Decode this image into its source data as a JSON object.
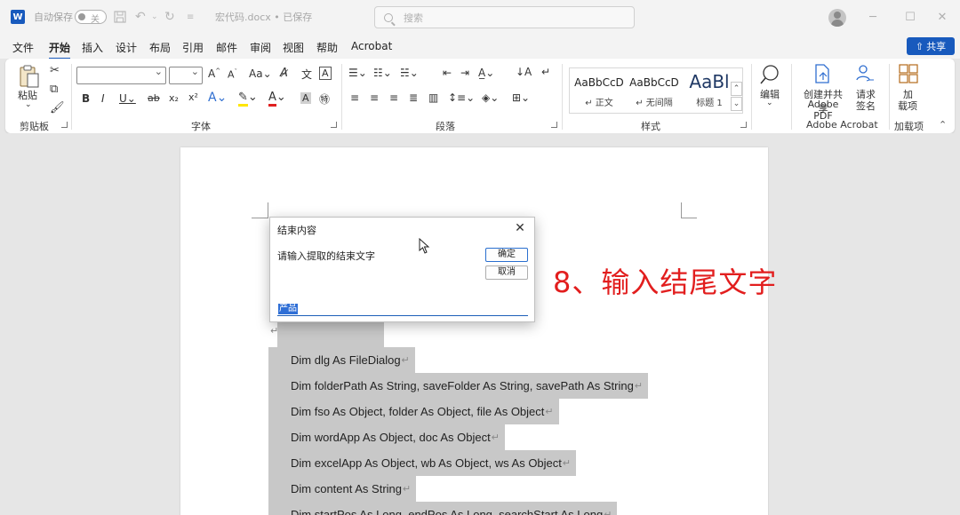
{
  "titlebar": {
    "app_logo": "W",
    "autosave_label": "自动保存",
    "autosave_state": "关",
    "doc_title": "宏代码.docx • 已保存",
    "search_placeholder": "搜索",
    "icons": [
      "word-logo",
      "save-icon",
      "undo-icon",
      "redo-icon",
      "customize-icon",
      "user-avatar",
      "minimize-icon",
      "maximize-icon",
      "close-icon"
    ]
  },
  "menu": {
    "items": [
      "文件",
      "开始",
      "插入",
      "设计",
      "布局",
      "引用",
      "邮件",
      "审阅",
      "视图",
      "帮助",
      "Acrobat"
    ],
    "active": "开始",
    "share_label": "共享"
  },
  "ribbon": {
    "groups": {
      "clipboard": {
        "label": "剪贴板",
        "paste_label": "粘贴"
      },
      "font": {
        "label": "字体",
        "font_name": "",
        "font_size": ""
      },
      "paragraph": {
        "label": "段落"
      },
      "styles": {
        "label": "样式",
        "items": [
          {
            "sample": "AaBbCcD",
            "name": "↵ 正文"
          },
          {
            "sample": "AaBbCcD",
            "name": "↵ 无间隔"
          },
          {
            "sample": "AaBl",
            "name": "标题 1"
          }
        ]
      },
      "editing": {
        "label": "编辑"
      },
      "adobe": {
        "label": "Adobe Acrobat",
        "create_share_line1": "创建并共享",
        "create_share_line2": "Adobe PDF",
        "sign_line1": "请求",
        "sign_line2": "签名"
      },
      "addins": {
        "label": "加载项",
        "button_line1": "加",
        "button_line2": "载项"
      }
    }
  },
  "document": {
    "code_lines": [
      "Dim dlg As FileDialog",
      "Dim folderPath As String, saveFolder As String, savePath As String",
      "Dim fso As Object, folder As Object, file As Object",
      "Dim wordApp As Object, doc As Object",
      "Dim excelApp As Object, wb As Object, ws As Object",
      "Dim content As String",
      "Dim startPos As Long, endPos As Long, searchStart As Long"
    ],
    "paragraph_mark": "↵"
  },
  "dialog": {
    "title": "结束内容",
    "prompt": "请输入提取的结束文字",
    "ok_label": "确定",
    "cancel_label": "取消",
    "input_value": "产品"
  },
  "annotation": {
    "text": "8、输入结尾文字",
    "color": "#e21e1e"
  },
  "colors": {
    "accent": "#185abd",
    "selection": "#c8c8c8"
  }
}
